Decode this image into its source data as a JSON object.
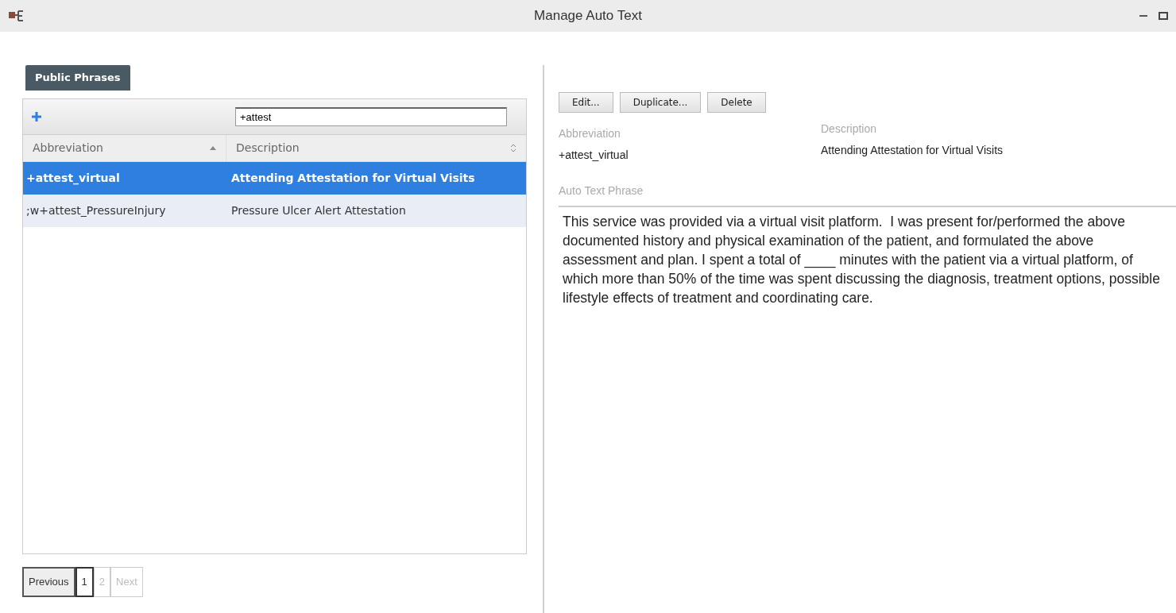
{
  "window": {
    "title": "Manage Auto Text"
  },
  "tabs": [
    {
      "label": "Public Phrases",
      "selected": true
    }
  ],
  "search": {
    "value": "+attest"
  },
  "table": {
    "columns": [
      {
        "label": "Abbreviation",
        "sorted": true
      },
      {
        "label": "Description",
        "sorted": false
      }
    ],
    "rows": [
      {
        "abbreviation": "+attest_virtual",
        "description": "Attending Attestation for Virtual Visits",
        "selected": true
      },
      {
        "abbreviation": ";w+attest_PressureInjury",
        "description": "Pressure Ulcer Alert Attestation",
        "selected": false
      }
    ]
  },
  "pagination": [
    {
      "label": "Previous",
      "selected": false,
      "disabled": false
    },
    {
      "label": "1",
      "selected": true,
      "disabled": false
    },
    {
      "label": "2",
      "selected": false,
      "disabled": true
    },
    {
      "label": "Next",
      "selected": false,
      "disabled": true
    }
  ],
  "buttons": [
    "Edit...",
    "Duplicate...",
    "Delete"
  ],
  "details": {
    "abbreviation_label": "Abbreviation",
    "abbreviation": "+attest_virtual",
    "description_label": "Description",
    "description": "Attending Attestation for Virtual Visits",
    "phrase_label": "Auto Text Phrase",
    "phrase": "This service was provided via a virtual visit platform.  I was present for/performed the above documented history and physical examination of the patient, and formulated the above assessment and plan. I spent a total of ____ minutes with the patient via a virtual platform, of which more than 50% of the time was spent discussing the diagnosis, treatment options, possible lifestyle effects of treatment and coordinating care."
  }
}
